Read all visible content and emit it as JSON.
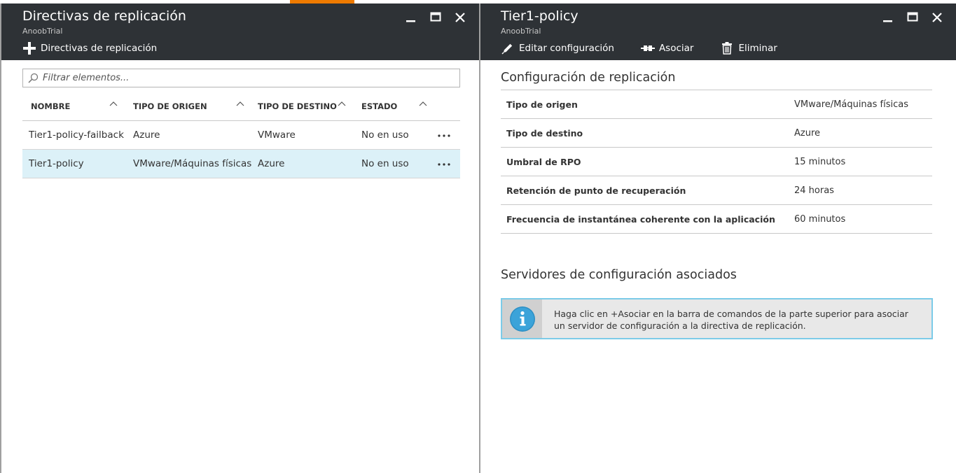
{
  "colors": {
    "header_bg": "#2e3236",
    "accent": "#ee7a00",
    "selected_row": "#dcf1f8",
    "info_border": "#7ccbe8",
    "info_icon": "#2d8fc4"
  },
  "left_blade": {
    "title": "Directivas de replicación",
    "subtitle": "AnoobTrial",
    "command": {
      "label": "Directivas de replicación",
      "icon": "plus-icon"
    },
    "filter": {
      "placeholder": "Filtrar elementos..."
    },
    "columns": [
      "NOMBRE",
      "TIPO DE ORIGEN",
      "TIPO DE DESTINO",
      "ESTADO"
    ],
    "rows": [
      {
        "name": "Tier1-policy-failback",
        "source": "Azure",
        "target": "VMware",
        "status": "No en uso",
        "selected": false
      },
      {
        "name": "Tier1-policy",
        "source": "VMware/Máquinas físicas",
        "target": "Azure",
        "status": "No en uso",
        "selected": true
      }
    ]
  },
  "right_blade": {
    "title": "Tier1-policy",
    "subtitle": "AnoobTrial",
    "commands": {
      "edit": "Editar configuración",
      "associate": "Asociar",
      "delete": "Eliminar"
    },
    "config_section_title": "Configuración de replicación",
    "properties": [
      {
        "label": "Tipo de origen",
        "value": "VMware/Máquinas físicas"
      },
      {
        "label": "Tipo de destino",
        "value": "Azure"
      },
      {
        "label": "Umbral de RPO",
        "value": "15 minutos"
      },
      {
        "label": "Retención de punto de recuperación",
        "value": "24 horas"
      },
      {
        "label": "Frecuencia de instantánea coherente con la aplicación",
        "value": "60 minutos"
      }
    ],
    "servers_section_title": "Servidores de configuración asociados",
    "info_message_line1": "Haga clic en +Asociar en la barra de comandos de la parte superior para asociar",
    "info_message_line2": "un servidor de configuración a la directiva de replicación."
  }
}
